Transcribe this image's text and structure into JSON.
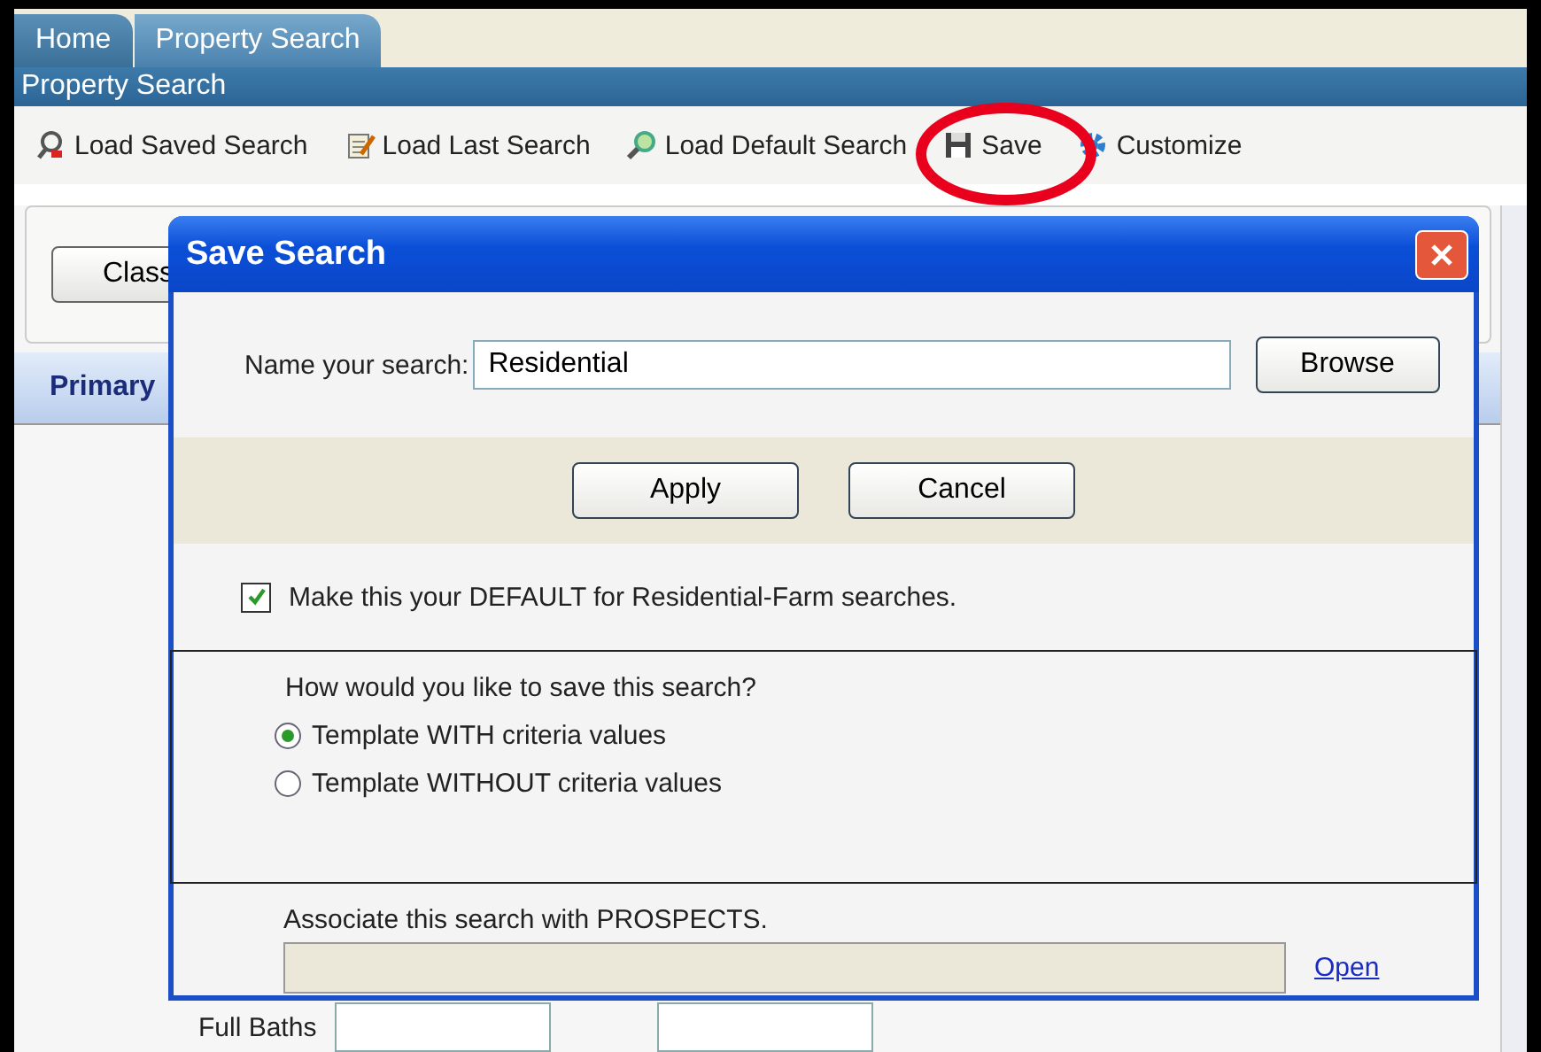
{
  "tabs": [
    {
      "label": "Home",
      "selected": false
    },
    {
      "label": "Property Search",
      "selected": true
    }
  ],
  "header": {
    "title": "Property Search"
  },
  "toolbar": [
    {
      "label": "Load Saved Search",
      "kind": "saved",
      "highlighted": false
    },
    {
      "label": "Load Last Search",
      "kind": "last",
      "highlighted": false
    },
    {
      "label": "Load Default Search",
      "kind": "default",
      "highlighted": false
    },
    {
      "label": "Save",
      "kind": "save",
      "highlighted": true
    },
    {
      "label": "Customize",
      "kind": "customize",
      "highlighted": false
    }
  ],
  "background": {
    "class_button": "Class",
    "section_tab": "Primary",
    "field_label": "Full Baths"
  },
  "dialog": {
    "title": "Save Search",
    "name_label": "Name your search:",
    "name_value": "Residential",
    "browse": "Browse",
    "buttons": [
      "Apply",
      "Cancel"
    ],
    "default_checkbox": {
      "label": "Make this your DEFAULT for Residential-Farm searches.",
      "checked": true
    },
    "save_mode": {
      "question": "How would you like to save this search?",
      "options": [
        {
          "label": "Template WITH criteria values",
          "selected": true
        },
        {
          "label": "Template WITHOUT criteria values",
          "selected": false
        }
      ]
    },
    "prospects": {
      "label": "Associate this search with PROSPECTS.",
      "link": "Open"
    }
  }
}
